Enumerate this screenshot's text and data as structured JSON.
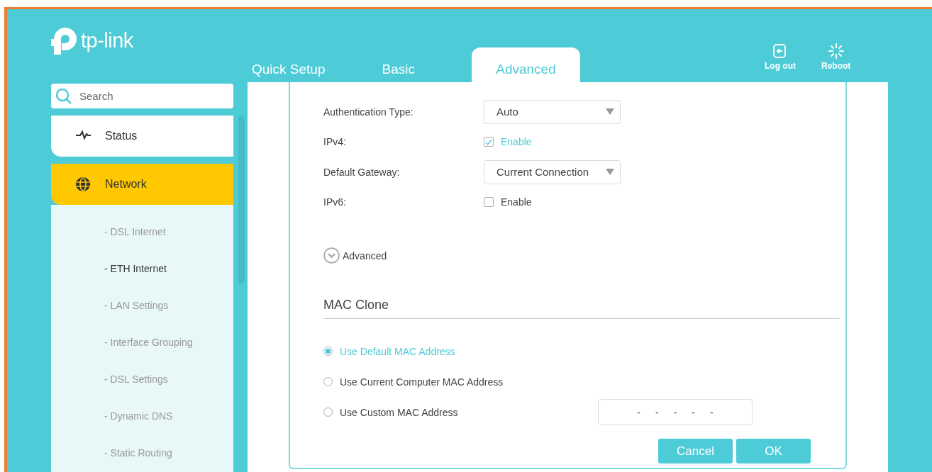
{
  "header": {
    "logo_text": "tp-link",
    "tabs": [
      {
        "label": "Quick Setup",
        "selected": false
      },
      {
        "label": "Basic",
        "selected": false
      },
      {
        "label": "Advanced",
        "selected": true
      }
    ],
    "actions": [
      {
        "label": "Log out",
        "kind": "logout"
      },
      {
        "label": "Reboot",
        "kind": "reboot"
      }
    ]
  },
  "sidebar": {
    "search": {
      "placeholder": "Search"
    },
    "items": [
      {
        "label": "Status",
        "kind": "status",
        "selected": false
      },
      {
        "label": "Network",
        "kind": "network",
        "selected": true,
        "children": [
          {
            "label": "- DSL Internet",
            "selected": false
          },
          {
            "label": "- ETH Internet",
            "selected": true
          },
          {
            "label": "- LAN Settings",
            "selected": false
          },
          {
            "label": "- Interface Grouping",
            "selected": false
          },
          {
            "label": "- DSL Settings",
            "selected": false
          },
          {
            "label": "- Dynamic DNS",
            "selected": false
          },
          {
            "label": "- Static Routing",
            "selected": false
          }
        ]
      }
    ]
  },
  "form": {
    "rows": [
      {
        "kind": "select",
        "label": "Authentication Type:",
        "value": "Auto"
      },
      {
        "kind": "checkbox",
        "label": "IPv4:",
        "option": "Enable",
        "checked": true
      },
      {
        "kind": "select",
        "label": "Default Gateway:",
        "value": "Current Connection"
      },
      {
        "kind": "checkbox",
        "label": "IPv6:",
        "option": "Enable",
        "checked": false
      }
    ],
    "advanced_toggle": {
      "label": "Advanced",
      "expanded": false
    },
    "mac_clone": {
      "title": "MAC Clone",
      "options": [
        {
          "label": "Use Default MAC Address",
          "selected": true
        },
        {
          "label": "Use Current Computer MAC Address",
          "selected": false
        },
        {
          "label": "Use Custom MAC Address",
          "selected": false
        }
      ],
      "mac_field": {
        "separators": [
          "-",
          "-",
          "-",
          "-",
          "-"
        ]
      }
    },
    "buttons": [
      "Cancel",
      "OK"
    ]
  }
}
